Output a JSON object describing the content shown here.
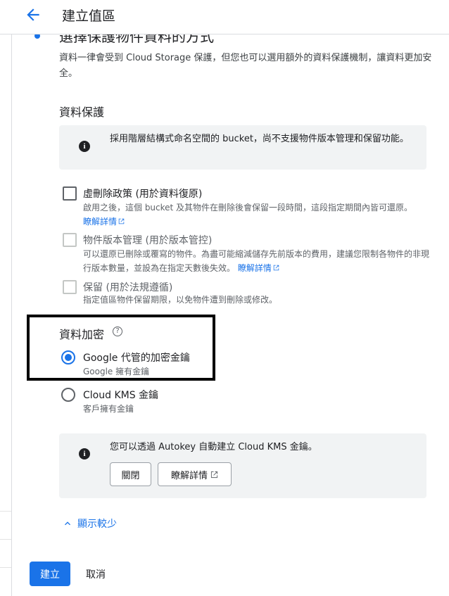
{
  "header": {
    "title": "建立值區",
    "back_icon": "arrow-back-icon"
  },
  "step": {
    "heading": "選擇保護物件資料的方式",
    "description": "資料一律會受到 Cloud Storage 保護，但您也可以選用額外的資料保護機制，讓資料更加安全。"
  },
  "data_protection": {
    "title": "資料保護",
    "info_text": "採用階層結構式命名空間的 bucket，尚不支援物件版本管理和保留功能。",
    "options": [
      {
        "label": "虛刪除政策 (用於資料復原)",
        "desc": "啟用之後，這個 bucket 及其物件在刪除後會保留一段時間，這段指定期間內皆可還原。",
        "link": "瞭解詳情",
        "enabled": true,
        "checked": false
      },
      {
        "label": "物件版本管理 (用於版本管控)",
        "desc": "可以還原已刪除或覆寫的物件。為盡可能縮減儲存先前版本的費用，建議您限制各物件的非現行版本數量，並設為在指定天數後失效。",
        "link": "瞭解詳情",
        "enabled": false,
        "checked": false
      },
      {
        "label": "保留 (用於法規遵循)",
        "desc": "指定值區物件保留期限，以免物件遭到刪除或修改。",
        "enabled": false,
        "checked": false
      }
    ]
  },
  "data_encryption": {
    "title": "資料加密",
    "help_icon": "?",
    "options": [
      {
        "label": "Google 代管的加密金鑰",
        "desc": "Google 擁有金鑰",
        "selected": true
      },
      {
        "label": "Cloud KMS 金鑰",
        "desc": "客戶擁有金鑰",
        "selected": false
      }
    ],
    "info_text": "您可以透過 Autokey 自動建立 Cloud KMS 金鑰。",
    "close_button": "關閉",
    "learn_more_button": "瞭解詳情"
  },
  "show_less": "顯示較少",
  "footer": {
    "create_button": "建立",
    "cancel_button": "取消"
  },
  "colors": {
    "accent": "#1a73e8",
    "text": "#202124",
    "muted": "#5f6368",
    "info_bg": "#f1f3f4"
  }
}
